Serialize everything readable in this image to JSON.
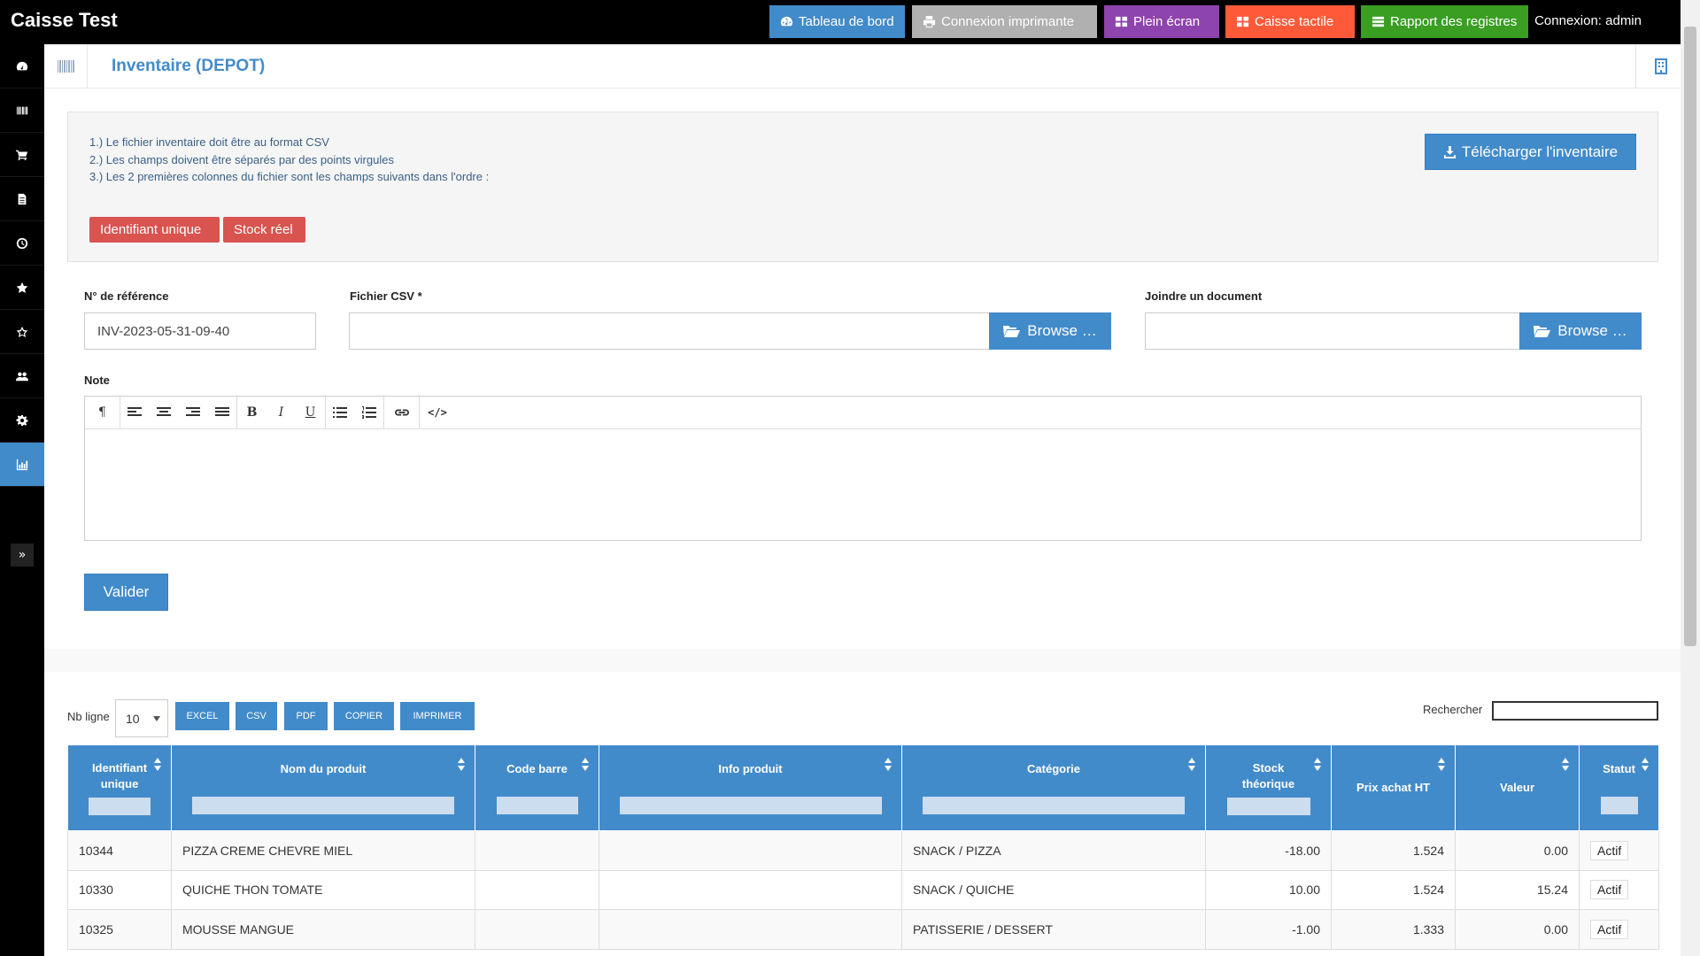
{
  "app": {
    "brand": "Caisse Test",
    "login": "Connexion: admin"
  },
  "topbar": {
    "buttons": [
      {
        "label": "Tableau de bord",
        "icon": "dashboard-icon",
        "color": "#428bca"
      },
      {
        "label": "Connexion imprimante",
        "icon": "print-icon",
        "color": "#b0b0b0"
      },
      {
        "label": "Plein écran",
        "icon": "grid-icon",
        "color": "#8e44ad"
      },
      {
        "label": "Caisse tactile",
        "icon": "grid-icon",
        "color": "#fe5a39"
      },
      {
        "label": "Rapport des registres",
        "icon": "list-icon",
        "color": "#3a9e23"
      }
    ]
  },
  "sidebar": {
    "items": [
      {
        "icon": "dashboard-icon"
      },
      {
        "icon": "barcode-icon"
      },
      {
        "icon": "cart-icon"
      },
      {
        "icon": "document-icon"
      },
      {
        "icon": "clock-icon"
      },
      {
        "icon": "star-filled-icon"
      },
      {
        "icon": "star-outline-icon"
      },
      {
        "icon": "users-icon"
      },
      {
        "icon": "gear-icon"
      },
      {
        "icon": "bar-chart-icon"
      }
    ],
    "active_index": 9,
    "toggle_icon": "double-chevron-right-icon"
  },
  "header": {
    "title": "Inventaire (DEPOT)",
    "left_icon": "barcode-icon",
    "right_icon": "building-icon"
  },
  "info": {
    "lines": [
      "1.) Le fichier inventaire doit être au format CSV",
      "2.) Les champs doivent être séparés par des points virgules",
      "3.) Les 2 premières colonnes du fichier sont les champs suivants dans l'ordre :"
    ],
    "badges": [
      "Identifiant unique",
      "Stock réel"
    ],
    "download_label": "Télécharger l'inventaire"
  },
  "form": {
    "ref_label": "N° de référence",
    "ref_value": "INV-2023-05-31-09-40",
    "csv_label": "Fichier CSV *",
    "csv_value": "",
    "doc_label": "Joindre un document",
    "doc_value": "",
    "browse_label": "Browse …",
    "note_label": "Note",
    "submit_label": "Valider"
  },
  "editor_toolbar": {
    "paragraph": "¶",
    "bold": "B",
    "italic": "I",
    "underline": "U",
    "code": "</>"
  },
  "table_controls": {
    "nb_label": "Nb ligne",
    "nb_value": "10",
    "export_buttons": [
      "EXCEL",
      "CSV",
      "PDF",
      "COPIER",
      "IMPRIMER"
    ],
    "search_label": "Rechercher",
    "search_value": ""
  },
  "table": {
    "columns": [
      "Identifiant unique",
      "Nom du produit",
      "Code barre",
      "Info produit",
      "Catégorie",
      "Stock théorique",
      "Prix achat HT",
      "Valeur",
      "Statut"
    ],
    "rows": [
      [
        "10344",
        "PIZZA CREME CHEVRE MIEL",
        "",
        "",
        "SNACK / PIZZA",
        "-18.00",
        "1.524",
        "0.00",
        "Actif"
      ],
      [
        "10330",
        "QUICHE THON TOMATE",
        "",
        "",
        "SNACK / QUICHE",
        "10.00",
        "1.524",
        "15.24",
        "Actif"
      ],
      [
        "10325",
        "MOUSSE MANGUE",
        "",
        "",
        "PATISSERIE / DESSERT",
        "-1.00",
        "1.333",
        "0.00",
        "Actif"
      ]
    ]
  }
}
